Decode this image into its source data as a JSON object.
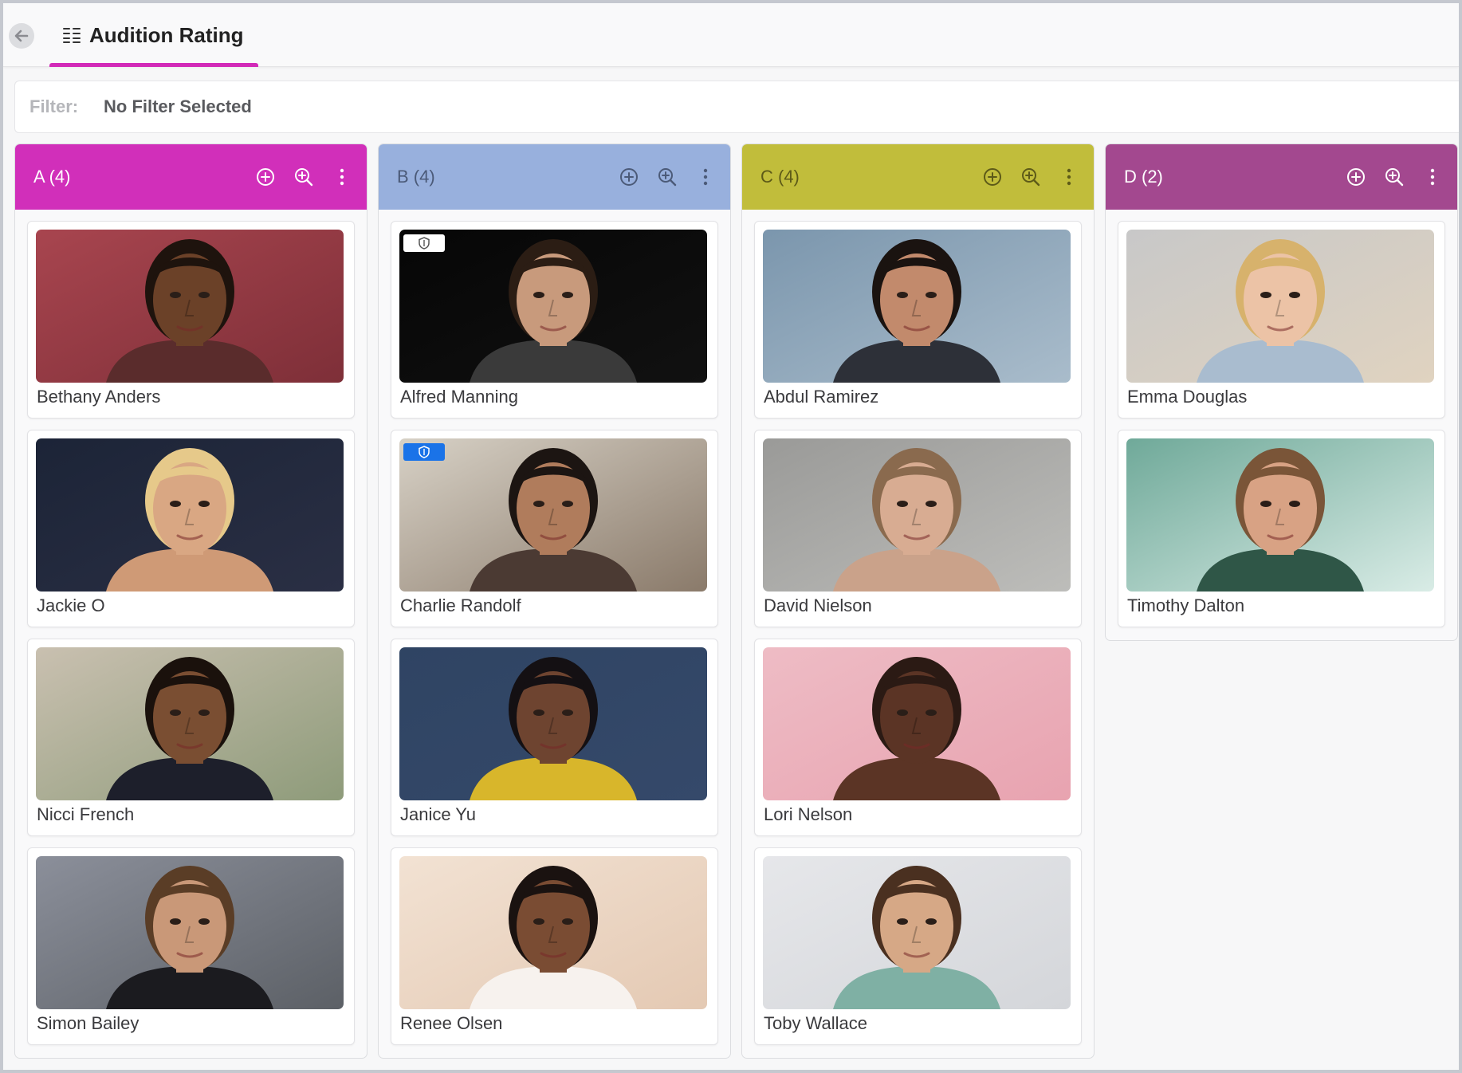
{
  "header": {
    "title": "Audition Rating",
    "accent": "#d22ab8"
  },
  "filter": {
    "label": "Filter:",
    "value": "No Filter Selected"
  },
  "columns": [
    {
      "title": "A (4)",
      "color": "#d12fba",
      "text_color": "#ffffff",
      "cards": [
        {
          "name": "Bethany Anders",
          "bg": [
            "#a8454f",
            "#7e2f38"
          ],
          "skin": "#6b4128",
          "hair": "#1e130d",
          "shirt": "#5a2c2c",
          "badge": ""
        },
        {
          "name": "Jackie O",
          "bg": [
            "#1c2437",
            "#2a2f44"
          ],
          "skin": "#d9a783",
          "hair": "#e6c98a",
          "shirt": "#cf9a76",
          "badge": ""
        },
        {
          "name": "Nicci French",
          "bg": [
            "#c9c0b0",
            "#8e9b7a"
          ],
          "skin": "#7a4e32",
          "hair": "#1a110c",
          "shirt": "#1d1f2b",
          "badge": ""
        },
        {
          "name": "Simon Bailey",
          "bg": [
            "#8b8f9a",
            "#5c6066"
          ],
          "skin": "#c99878",
          "hair": "#5a3d26",
          "shirt": "#1b1b1f",
          "badge": ""
        }
      ]
    },
    {
      "title": "B (4)",
      "color": "#98b0dd",
      "text_color": "#4b5a78",
      "cards": [
        {
          "name": "Alfred Manning",
          "bg": [
            "#060606",
            "#111111"
          ],
          "skin": "#c89a7c",
          "hair": "#2b1d14",
          "shirt": "#3a3a3a",
          "badge": "white"
        },
        {
          "name": "Charlie Randolf",
          "bg": [
            "#d7d1c6",
            "#8a7a6a"
          ],
          "skin": "#b07c5c",
          "hair": "#1c1512",
          "shirt": "#4b3a33",
          "badge": "blue"
        },
        {
          "name": "Janice Yu",
          "bg": [
            "#2f4463",
            "#35496a"
          ],
          "skin": "#6e4430",
          "hair": "#141013",
          "shirt": "#d8b62b",
          "badge": ""
        },
        {
          "name": "Renee Olsen",
          "bg": [
            "#f2e2d3",
            "#e4c9b3"
          ],
          "skin": "#7a4c33",
          "hair": "#1a1210",
          "shirt": "#f7f2ee",
          "badge": ""
        }
      ]
    },
    {
      "title": "C (4)",
      "color": "#c1bd3b",
      "text_color": "#5d5a18",
      "cards": [
        {
          "name": "Abdul Ramirez",
          "bg": [
            "#7b96ad",
            "#a9bccb"
          ],
          "skin": "#c28a6c",
          "hair": "#1a1310",
          "shirt": "#2d3038",
          "badge": ""
        },
        {
          "name": "David Nielson",
          "bg": [
            "#9a9a98",
            "#bdbdba"
          ],
          "skin": "#d8ac92",
          "hair": "#8a6a4e",
          "shirt": "#caa28a",
          "badge": ""
        },
        {
          "name": "Lori Nelson",
          "bg": [
            "#eebcc5",
            "#e8a3b0"
          ],
          "skin": "#5b3425",
          "hair": "#2b1a14",
          "shirt": "#5b3425",
          "badge": ""
        },
        {
          "name": "Toby Wallace",
          "bg": [
            "#e6e7ea",
            "#d4d6da"
          ],
          "skin": "#d6a886",
          "hair": "#4a3020",
          "shirt": "#7fb0a4",
          "badge": ""
        }
      ]
    },
    {
      "title": "D (2)",
      "color": "#a3488f",
      "text_color": "#ffffff",
      "cards": [
        {
          "name": "Emma Douglas",
          "bg": [
            "#c8c8c8",
            "#e0d3c0"
          ],
          "skin": "#ecc3a6",
          "hair": "#d7b26c",
          "shirt": "#a9bccf",
          "badge": ""
        },
        {
          "name": "Timothy Dalton",
          "bg": [
            "#6fa999",
            "#d9ece6"
          ],
          "skin": "#d8a284",
          "hair": "#7a5538",
          "shirt": "#2f5647",
          "badge": ""
        }
      ]
    }
  ]
}
